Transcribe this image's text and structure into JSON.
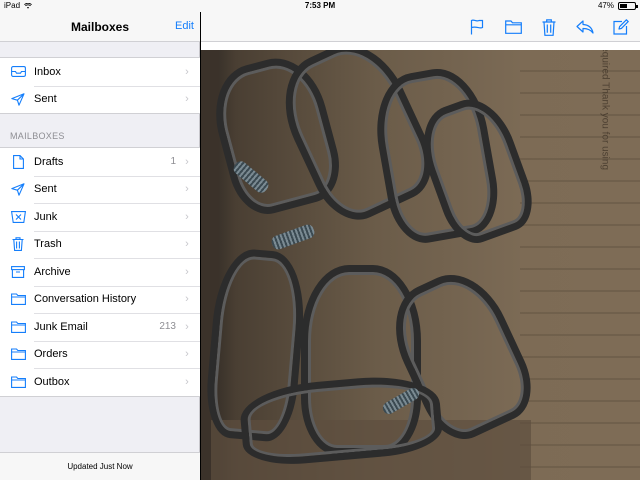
{
  "status_bar": {
    "device": "iPad",
    "time": "7:53 PM",
    "battery_percent": "47%",
    "battery_level": 0.47
  },
  "sidebar": {
    "title": "Mailboxes",
    "edit_label": "Edit",
    "top_items": [
      {
        "label": "Inbox",
        "icon": "inbox-icon"
      },
      {
        "label": "Sent",
        "icon": "paper-plane-icon"
      }
    ],
    "section_title": "MAILBOXES",
    "mailboxes": [
      {
        "label": "Drafts",
        "icon": "document-icon",
        "count": "1"
      },
      {
        "label": "Sent",
        "icon": "paper-plane-icon",
        "count": ""
      },
      {
        "label": "Junk",
        "icon": "junk-bin-icon",
        "count": ""
      },
      {
        "label": "Trash",
        "icon": "trash-icon",
        "count": ""
      },
      {
        "label": "Archive",
        "icon": "archive-box-icon",
        "count": ""
      },
      {
        "label": "Conversation History",
        "icon": "folder-icon",
        "count": ""
      },
      {
        "label": "Junk Email",
        "icon": "folder-icon",
        "count": "213"
      },
      {
        "label": "Orders",
        "icon": "folder-icon",
        "count": ""
      },
      {
        "label": "Outbox",
        "icon": "folder-icon",
        "count": ""
      }
    ],
    "footer_text": "Updated Just Now"
  },
  "toolbar": {
    "tools": [
      "flag-icon",
      "folder-icon",
      "trash-icon",
      "reply-icon",
      "compose-icon"
    ]
  },
  "photo": {
    "print_text": "Priority Mail  postage required  Thank you for using"
  },
  "colors": {
    "accent": "#147efb",
    "sidebar_bg": "#efeff4",
    "chevron": "#c7c7cc"
  }
}
